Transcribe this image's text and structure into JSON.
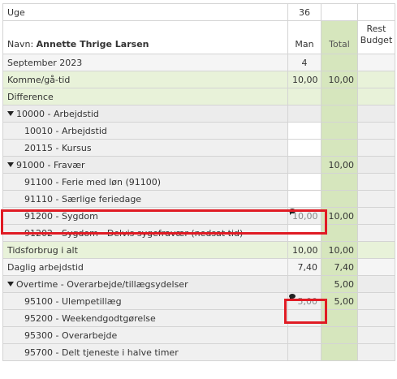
{
  "header": {
    "week_label": "Uge",
    "week_value": "36",
    "name_label": "Navn: ",
    "name_value": "Annette Thrige Larsen",
    "col_man": "Man",
    "col_total": "Total",
    "col_rest": "Rest Budget",
    "month_label": "September 2023",
    "month_day": "4"
  },
  "rows": {
    "komme": {
      "label": "Komme/gå-tid",
      "man": "10,00",
      "total": "10,00"
    },
    "difference": {
      "label": "Difference"
    },
    "g10000": {
      "label": "10000 - Arbejdstid"
    },
    "r10010": {
      "label": "10010 - Arbejdstid"
    },
    "r20115": {
      "label": "20115 - Kursus"
    },
    "g91000": {
      "label": "91000 - Fravær",
      "total": "10,00"
    },
    "r91100": {
      "label": "91100 - Ferie med løn (91100)"
    },
    "r91110": {
      "label": "91110 - Særlige feriedage"
    },
    "r91200": {
      "label": "91200 - Sygdom",
      "man": "10,00",
      "total": "10,00"
    },
    "r91202": {
      "label": "91202 - Sygdom - Delvis sygefravær (nedsat tid)"
    },
    "tidsforbrug": {
      "label": "Tidsforbrug i alt",
      "man": "10,00",
      "total": "10,00"
    },
    "daglig": {
      "label": "Daglig arbejdstid",
      "man": "7,40",
      "total": "7,40"
    },
    "overtime": {
      "label": "Overtime - Overarbejde/tillægsydelser",
      "total": "5,00"
    },
    "r95100": {
      "label": "95100 - Ulempetillæg",
      "man": "5,00",
      "total": "5,00"
    },
    "r95200": {
      "label": "95200 - Weekendgodtgørelse"
    },
    "r95300": {
      "label": "95300 - Overarbejde"
    },
    "r95700": {
      "label": "95700 - Delt tjeneste i halve timer"
    }
  },
  "icons": {
    "note": "comment-icon",
    "expand": "triangle-down-icon"
  },
  "colors": {
    "total_column": "#d6e6bd",
    "green_row": "#e8f2d9",
    "highlight": "#e01b24"
  }
}
